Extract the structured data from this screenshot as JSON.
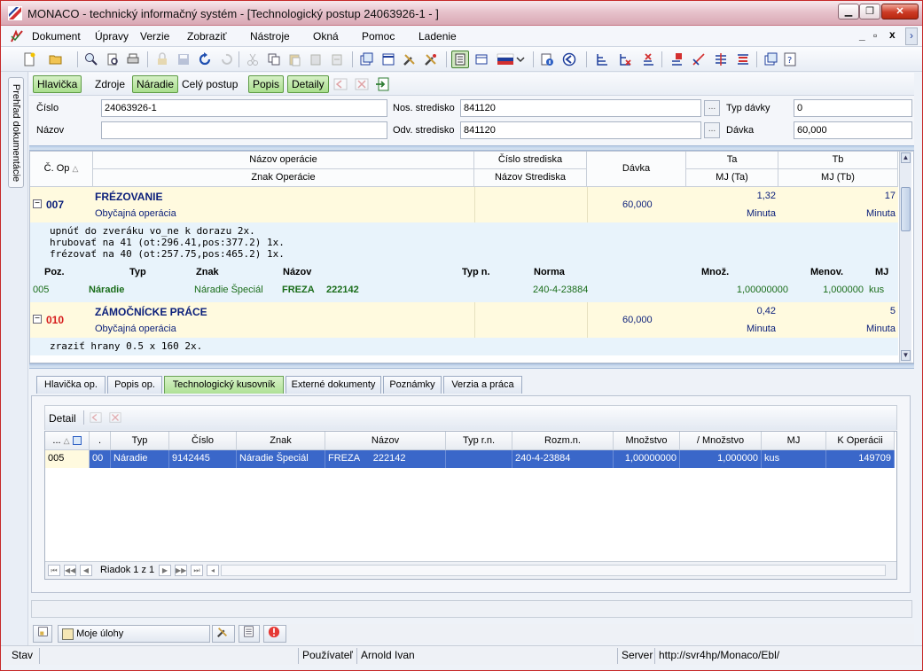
{
  "window": {
    "title": "MONACO - technický informačný systém - [Technologický postup 24063926-1 - ]",
    "controls": {
      "minimize": "▁",
      "restore": "❐",
      "close": "✕"
    }
  },
  "menu": {
    "items": [
      "Dokument",
      "Úpravy",
      "Verzie",
      "Zobraziť",
      "Nástroje",
      "Okná",
      "Pomoc",
      "Ladenie"
    ],
    "mdi_controls": {
      "minimize": "_",
      "restore": "▫",
      "close": "x",
      "scroll": "›"
    }
  },
  "sidebar": {
    "label": "Prehľad dokumentácie"
  },
  "subtoolbar": {
    "hlavicka": "Hlavička",
    "zdroje": "Zdroje",
    "naradie": "Náradie",
    "cely_postup": "Celý postup",
    "popis": "Popis",
    "detaily": "Detaily"
  },
  "form": {
    "cislo_label": "Číslo",
    "cislo_value": "24063926-1",
    "nazov_label": "Názov",
    "nazov_value": "",
    "nos_label": "Nos. stredisko",
    "nos_value": "841120",
    "odv_label": "Odv. stredisko",
    "odv_value": "841120",
    "typ_davky_label": "Typ dávky",
    "typ_davky_value": "0",
    "davka_label": "Dávka",
    "davka_value": "60,000",
    "ellipsis": "..."
  },
  "ops_grid": {
    "headers": {
      "cop": "Č. Op",
      "nazov_operacie": "Názov operácie",
      "znak_operacie": "Znak Operácie",
      "cislo_strediska": "Číslo strediska",
      "nazov_strediska": "Názov Strediska",
      "davka": "Dávka",
      "ta": "Ta",
      "mj_ta": "MJ (Ta)",
      "tb": "Tb",
      "mj_tb": "MJ (Tb)"
    },
    "operations": [
      {
        "cop": "007",
        "name": "FRÉZOVANIE",
        "kind": "Obyčajná operácia",
        "davka": "60,000",
        "ta": "1,32",
        "ta_unit": "Minuta",
        "tb": "17",
        "tb_unit": "Minuta",
        "desc": [
          "upnúť do zveráku vo_ne k dorazu 2x.",
          "hrubovať na 41 (ot:296.41,pos:377.2) 1x.",
          "frézovať na 40 (ot:257.75,pos:465.2) 1x."
        ]
      },
      {
        "cop": "010",
        "name": "ZÁMOČNÍCKE PRÁCE",
        "kind": "Obyčajná operácia",
        "davka": "60,000",
        "ta": "0,42",
        "ta_unit": "Minuta",
        "tb": "5",
        "tb_unit": "Minuta",
        "desc": [
          "zraziť hrany 0.5 x 160 2x."
        ]
      }
    ],
    "tool_header": {
      "poz": "Poz.",
      "typ": "Typ",
      "znak": "Znak",
      "nazov": "Názov",
      "typn": "Typ n.",
      "norma": "Norma",
      "mnoz": "Množ.",
      "menov": "Menov.",
      "mj": "MJ"
    },
    "tool_row": {
      "poz": "005",
      "typ": "Náradie",
      "znak": "Náradie Špeciál",
      "nazov": "FREZA",
      "nazov2": "222142",
      "norma": "240-4-23884",
      "mnoz": "1,00000000",
      "menov": "1,000000",
      "mj": "kus"
    }
  },
  "tabs": [
    "Hlavička op.",
    "Popis op.",
    "Technologický kusovník",
    "Externé dokumenty",
    "Poznámky",
    "Verzia a práca"
  ],
  "active_tab": "Technologický kusovník",
  "detail": {
    "label": "Detail",
    "columns": [
      "...",
      ".",
      "Typ",
      "Číslo",
      "Znak",
      "Názov",
      "Typ r.n.",
      "Rozm.n.",
      "Množstvo",
      "/ Množstvo",
      "MJ",
      "K Operácii"
    ],
    "rows": [
      [
        "005",
        "00",
        "Náradie",
        "9142445",
        "Náradie Špeciál",
        "FREZA     222142",
        "",
        "240-4-23884",
        "1,00000000",
        "1,000000",
        "kus",
        "149709"
      ]
    ],
    "pager": "Riadok 1 z 1"
  },
  "taskbar": {
    "moje_ulohy": "Moje úlohy"
  },
  "status": {
    "stav": "Stav",
    "pouzivatel_label": "Používateľ",
    "pouzivatel": "Arnold Ivan",
    "server_label": "Server",
    "server": "http://svr4hp/Monaco/Ebl/"
  }
}
